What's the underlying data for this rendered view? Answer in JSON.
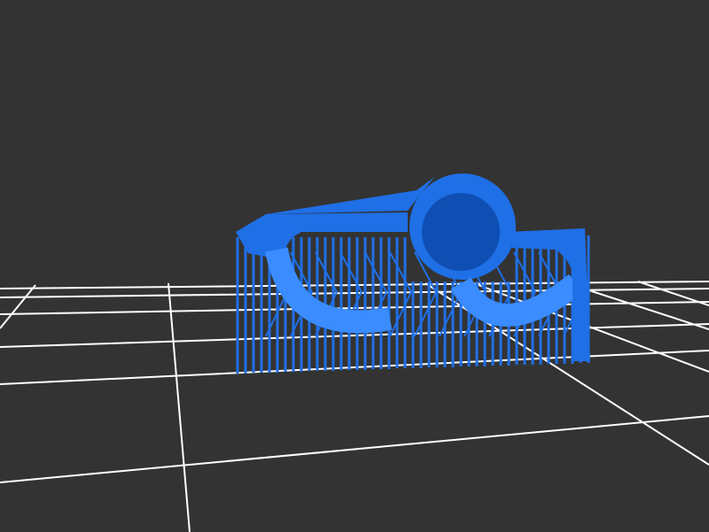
{
  "viewer": {
    "background_color": "#333333",
    "grid_color": "#ffffff",
    "model_color": "#1f6fe6",
    "model_shade_light": "#3a8cff",
    "model_shade_dark": "#0f4fb3"
  }
}
